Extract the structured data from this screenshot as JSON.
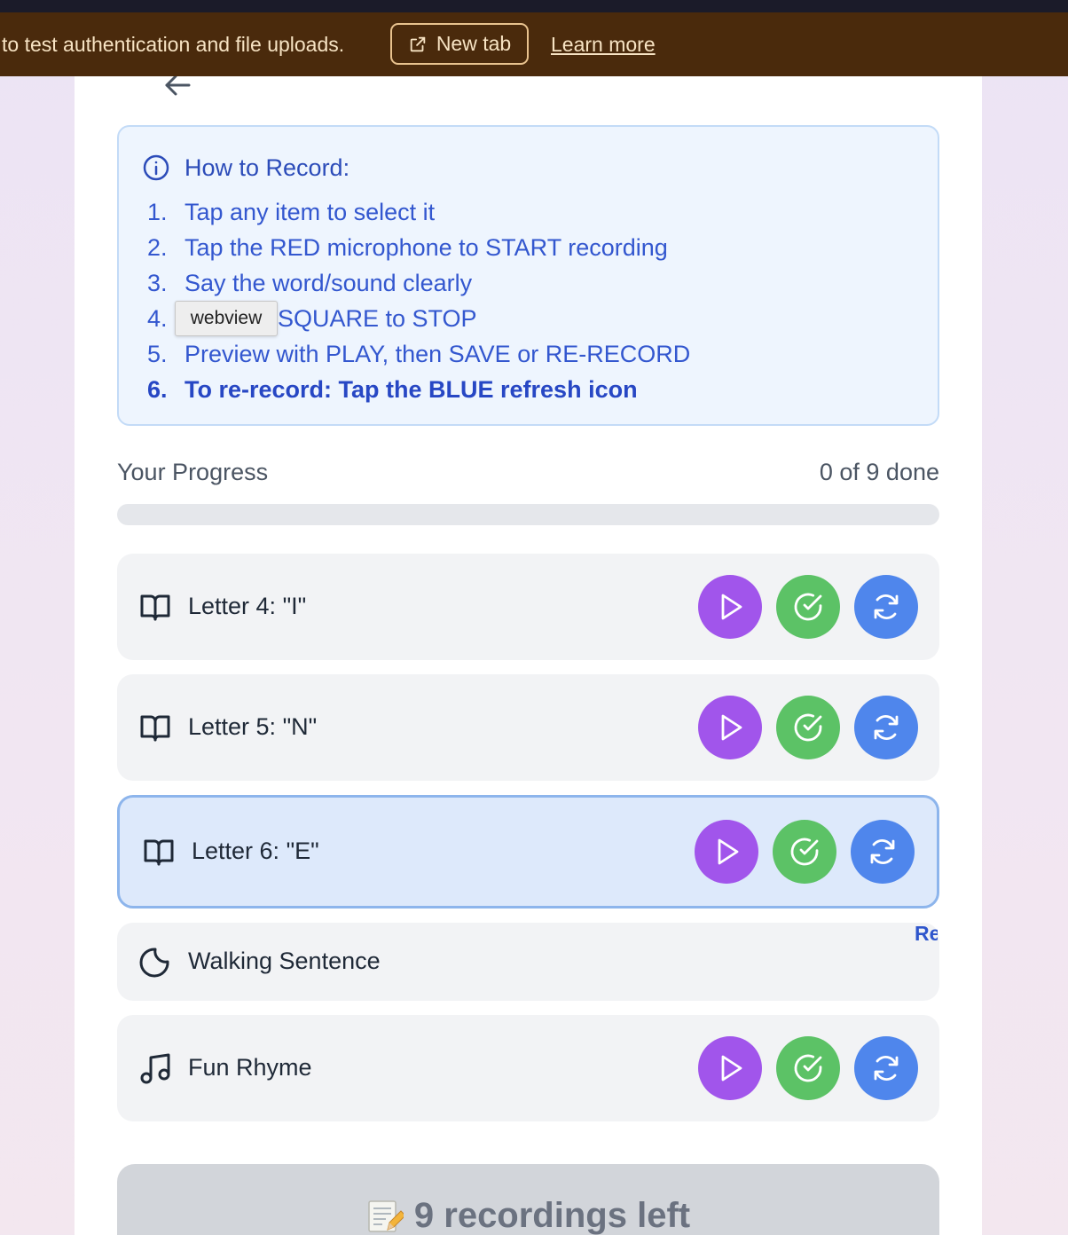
{
  "banner": {
    "text": "to test authentication and file uploads.",
    "new_tab_label": "New tab",
    "learn_more_label": "Learn more"
  },
  "instructions": {
    "title": "How to Record:",
    "steps": [
      {
        "num": "1.",
        "text": "Tap any item to select it"
      },
      {
        "num": "2.",
        "text": "Tap the RED microphone to START recording"
      },
      {
        "num": "3.",
        "text": "Say the word/sound clearly"
      },
      {
        "num": "4.",
        "text": "SQUARE to STOP"
      },
      {
        "num": "5.",
        "text": "Preview with PLAY, then SAVE or RE-RECORD"
      },
      {
        "num": "6.",
        "text": "To re-record: Tap the BLUE refresh icon"
      }
    ],
    "tooltip": "webview"
  },
  "progress": {
    "label": "Your Progress",
    "count_text": "0 of 9 done",
    "fraction": 0
  },
  "items": [
    {
      "label": "Letter 4: \"I\"",
      "icon": "book-icon",
      "selected": false
    },
    {
      "label": "Letter 5: \"N\"",
      "icon": "book-icon",
      "selected": false
    },
    {
      "label": "Letter 6: \"E\"",
      "icon": "book-icon",
      "selected": true
    },
    {
      "label": "Walking Sentence",
      "icon": "moon-icon",
      "selected": false,
      "truncated_text": "Re in"
    },
    {
      "label": "Fun Rhyme",
      "icon": "music-note-icon",
      "selected": false
    }
  ],
  "submit": {
    "emoji": "memo-icon",
    "label": "9 recordings left"
  },
  "colors": {
    "banner_bg": "#4a2a0c",
    "play": "#a155eb",
    "save": "#5cc266",
    "rerecord": "#4f86ec",
    "instructions_text": "#3357cf"
  }
}
